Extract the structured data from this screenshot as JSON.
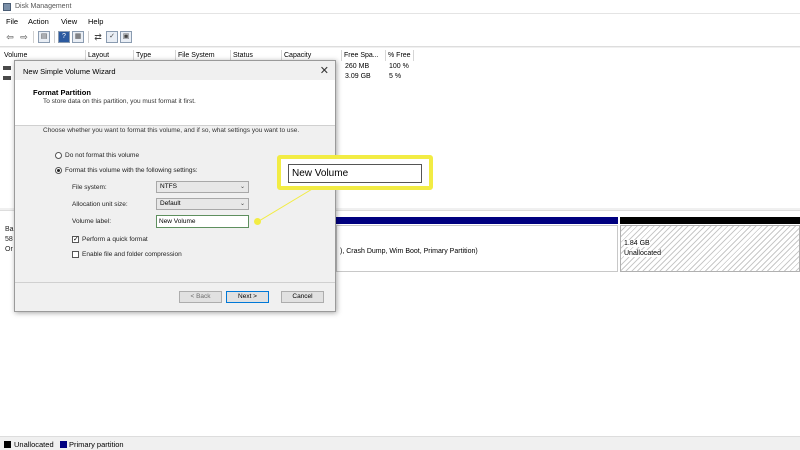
{
  "window": {
    "title": "Disk Management"
  },
  "menu": [
    "File",
    "Action",
    "View",
    "Help"
  ],
  "columns": [
    "Volume",
    "Layout",
    "Type",
    "File System",
    "Status",
    "Capacity",
    "Free Spa...",
    "% Free"
  ],
  "rows": [
    {
      "free": "260 MB",
      "pct": "100 %"
    },
    {
      "free": "3.09 GB",
      "pct": "5 %"
    }
  ],
  "disk": {
    "label_lines": [
      "Ba",
      "58",
      "Or"
    ],
    "partition_text": "), Crash Dump, Wim Boot, Primary Partition)",
    "unallocated_size": "1.84 GB",
    "unallocated_label": "Unallocated"
  },
  "legend": [
    {
      "label": "Unallocated",
      "color": "#000000"
    },
    {
      "label": "Primary partition",
      "color": "#00007f"
    }
  ],
  "wizard": {
    "title": "New Simple Volume Wizard",
    "heading": "Format Partition",
    "subheading": "To store data on this partition, you must format it first.",
    "question": "Choose whether you want to format this volume, and if so, what settings you want to use.",
    "option_no_format": "Do not format this volume",
    "option_format": "Format this volume with the following settings:",
    "fs_label": "File system:",
    "fs_value": "NTFS",
    "alloc_label": "Allocation unit size:",
    "alloc_value": "Default",
    "vol_label": "Volume label:",
    "vol_value": "New Volume",
    "quick_format": "Perform a quick format",
    "compression": "Enable file and folder compression",
    "back": "< Back",
    "next": "Next >",
    "cancel": "Cancel"
  },
  "callout": {
    "text": "New Volume"
  }
}
